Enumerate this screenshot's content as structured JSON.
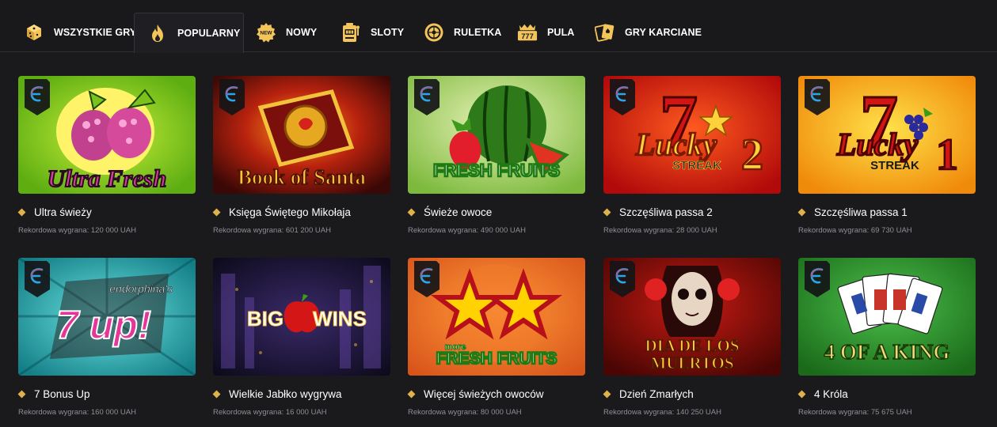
{
  "tabs": [
    {
      "label": "WSZYSTKIE GRY",
      "icon": "dice-icon",
      "active": false
    },
    {
      "label": "POPULARNY",
      "icon": "flame-icon",
      "active": true
    },
    {
      "label": "NOWY",
      "icon": "new-badge-icon",
      "active": false
    },
    {
      "label": "SLOTY",
      "icon": "slot-machine-icon",
      "active": false
    },
    {
      "label": "RULETKA",
      "icon": "roulette-icon",
      "active": false
    },
    {
      "label": "PULA",
      "icon": "jackpot-777-icon",
      "active": false
    },
    {
      "label": "GRY KARCIANE",
      "icon": "cards-icon",
      "active": false
    }
  ],
  "games": [
    {
      "title": "Ultra świeży",
      "record_label": "Rekordowa wygrana:",
      "record_value": "120 000 UAH",
      "art_text": "Ultra Fresh"
    },
    {
      "title": "Księga Świętego Mikołaja",
      "record_label": "Rekordowa wygrana:",
      "record_value": "601 200 UAH",
      "art_text": "Book of Santa"
    },
    {
      "title": "Świeże owoce",
      "record_label": "Rekordowa wygrana:",
      "record_value": "490 000 UAH",
      "art_text": "FRESH FRUITS"
    },
    {
      "title": "Szczęśliwa passa 2",
      "record_label": "Rekordowa wygrana:",
      "record_value": "28 000 UAH",
      "art_text": "Lucky",
      "art_text2": "STREAK",
      "art_num": "2"
    },
    {
      "title": "Szczęśliwa passa 1",
      "record_label": "Rekordowa wygrana:",
      "record_value": "69 730 UAH",
      "art_text": "Lucky",
      "art_text2": "STREAK",
      "art_num": "1"
    },
    {
      "title": "7 Bonus Up",
      "record_label": "Rekordowa wygrana:",
      "record_value": "160 000 UAH",
      "art_text": "7 up!",
      "art_text2": "endorphina's"
    },
    {
      "title": "Wielkie Jabłko wygrywa",
      "record_label": "Rekordowa wygrana:",
      "record_value": "16 000 UAH",
      "art_text": "BIG",
      "art_text2": "WINS"
    },
    {
      "title": "Więcej świeżych owoców",
      "record_label": "Rekordowa wygrana:",
      "record_value": "80 000 UAH",
      "art_text": "FRESH FRUITS",
      "art_text2": "more"
    },
    {
      "title": "Dzień Zmarłych",
      "record_label": "Rekordowa wygrana:",
      "record_value": "140 250 UAH",
      "art_text": "DIA DE LOS",
      "art_text2": "MUERTOS"
    },
    {
      "title": "4 Króla",
      "record_label": "Rekordowa wygrana:",
      "record_value": "75 675 UAH",
      "art_text": "4 OF A KING"
    }
  ],
  "colors": {
    "background": "#1a1a1d",
    "accent_gold": "#e0b24a",
    "muted_text": "#8e8e96"
  }
}
